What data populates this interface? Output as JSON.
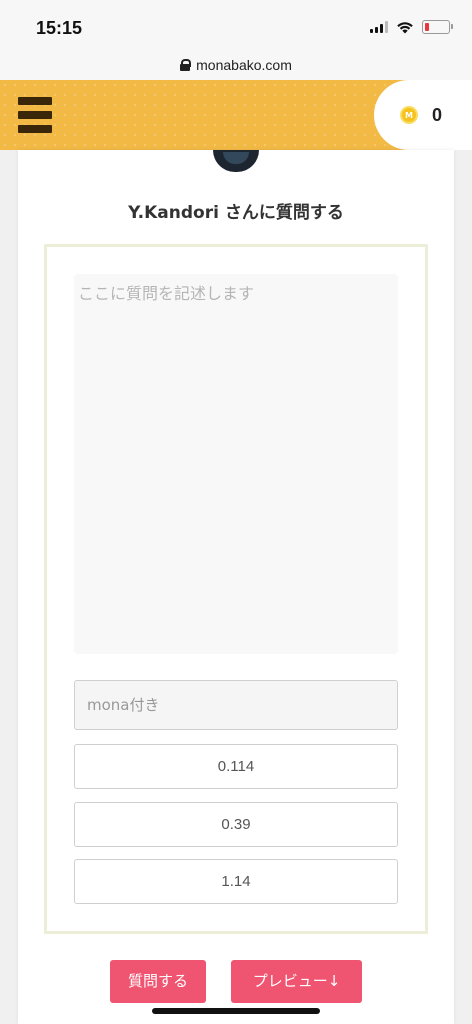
{
  "status_bar": {
    "time": "15:15"
  },
  "browser": {
    "url": "monabako.com"
  },
  "header": {
    "coin_symbol": "M",
    "coin_count": "0"
  },
  "question_form": {
    "title": "Y.Kandori さんに質問する",
    "textarea_placeholder": "ここに質問を記述します",
    "mona_placeholder": "mona付き",
    "amounts": [
      "0.114",
      "0.39",
      "1.14"
    ],
    "submit_label": "質問する",
    "preview_label": "プレビュー↓"
  },
  "colors": {
    "header_bg": "#f2b944",
    "menu_icon": "#3a2608",
    "action_button": "#ef5571",
    "frame_border": "#eceed8",
    "battery_low": "#e8363f"
  }
}
